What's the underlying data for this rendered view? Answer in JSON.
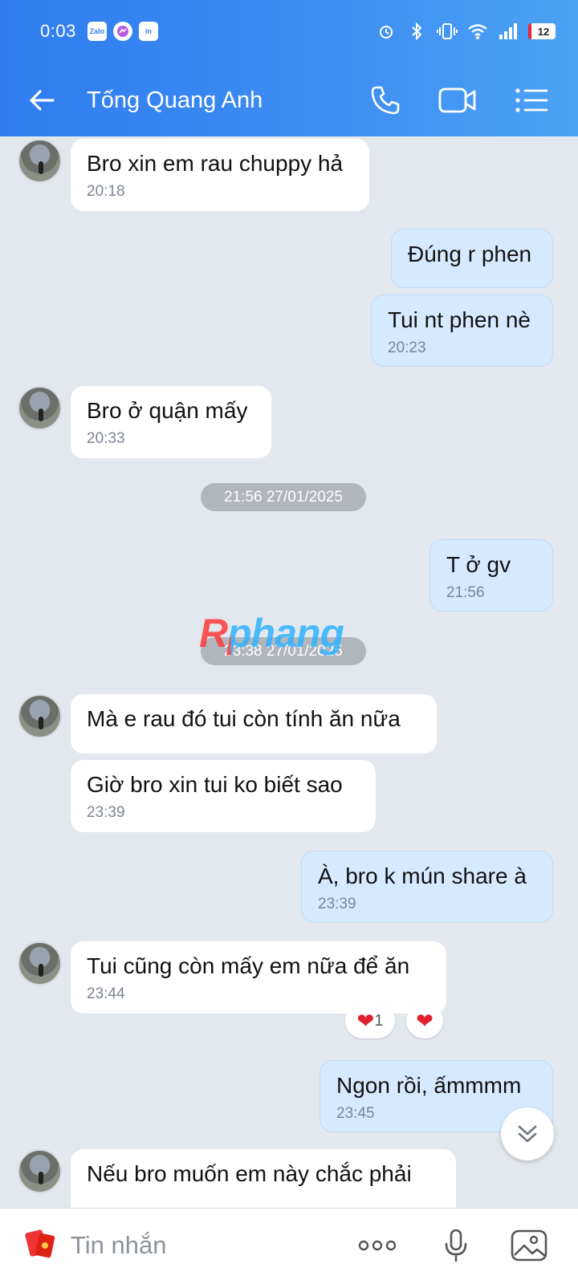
{
  "status_bar": {
    "time": "0:03",
    "battery": "12",
    "apps": [
      "Zalo",
      "in"
    ]
  },
  "header": {
    "contact_name": "Tống Quang Anh"
  },
  "messages": [
    {
      "text": "Bro xin em rau chuppy hả",
      "time": "20:18"
    },
    {
      "text": "Đúng r phen"
    },
    {
      "text": "Tui nt phen nè",
      "time": "20:23"
    },
    {
      "text": "Bro ở quận mấy",
      "time": "20:33"
    },
    {
      "text": "T ở gv",
      "time": "21:56"
    },
    {
      "text": "Mà e rau đó tui còn tính ăn nữa"
    },
    {
      "text": "Giờ bro xin tui ko biết sao",
      "time": "23:39"
    },
    {
      "text": "À, bro k mún share à",
      "time": "23:39"
    },
    {
      "text": "Tui cũng còn mấy em nữa để ăn",
      "time": "23:44"
    },
    {
      "text": "Ngon rồi, ấmmmm",
      "time": "23:45"
    },
    {
      "text": "Nếu bro muốn em này chắc phải"
    }
  ],
  "separators": [
    "21:56 27/01/2025",
    "23:38 27/01/2025"
  ],
  "reaction": {
    "count": "1",
    "heart": "❤"
  },
  "watermark": "Rphang",
  "composer": {
    "placeholder": "Tin nhắn"
  }
}
